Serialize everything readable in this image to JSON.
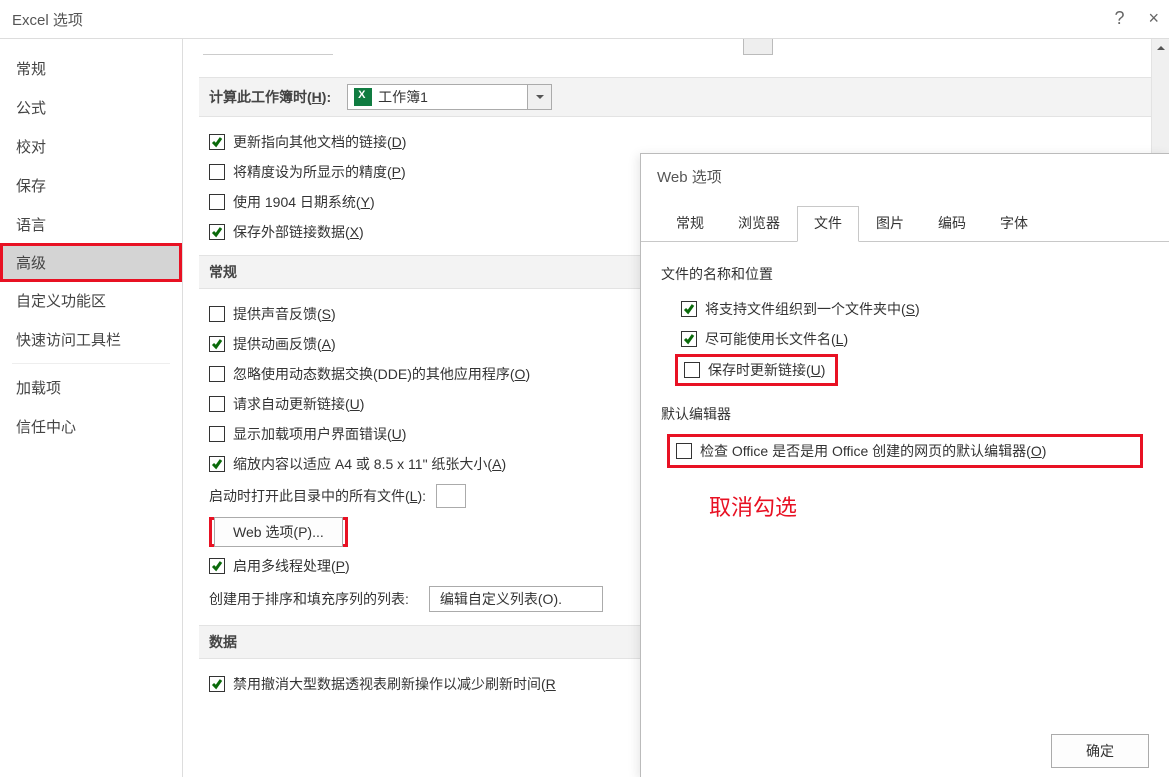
{
  "window": {
    "title": "Excel 选项",
    "help_icon": "?",
    "close_icon": "×"
  },
  "sidebar": {
    "items": [
      {
        "label": "常规"
      },
      {
        "label": "公式"
      },
      {
        "label": "校对"
      },
      {
        "label": "保存"
      },
      {
        "label": "语言"
      },
      {
        "label": "高级",
        "selected": true
      },
      {
        "label": "自定义功能区"
      },
      {
        "label": "快速访问工具栏"
      },
      {
        "label": "加载项"
      },
      {
        "label": "信任中心"
      }
    ]
  },
  "workbook_section": {
    "heading_prefix": "计算此工作簿时(",
    "heading_hotkey": "H",
    "heading_suffix": "):",
    "workbook_name": "工作簿1",
    "options": [
      {
        "checked": true,
        "text": "更新指向其他文档的链接(",
        "hot": "D",
        "tail": ")"
      },
      {
        "checked": false,
        "text": "将精度设为所显示的精度(",
        "hot": "P",
        "tail": ")"
      },
      {
        "checked": false,
        "text": "使用 1904 日期系统(",
        "hot": "Y",
        "tail": ")"
      },
      {
        "checked": true,
        "text": "保存外部链接数据(",
        "hot": "X",
        "tail": ")"
      }
    ]
  },
  "general_section": {
    "heading": "常规",
    "options": [
      {
        "checked": false,
        "text": "提供声音反馈(",
        "hot": "S",
        "tail": ")"
      },
      {
        "checked": true,
        "text": "提供动画反馈(",
        "hot": "A",
        "tail": ")"
      },
      {
        "checked": false,
        "text": "忽略使用动态数据交换(DDE)的其他应用程序(",
        "hot": "O",
        "tail": ")"
      },
      {
        "checked": false,
        "text": "请求自动更新链接(",
        "hot": "U",
        "tail": ")"
      },
      {
        "checked": false,
        "text": "显示加载项用户界面错误(",
        "hot": "U",
        "tail": ")"
      },
      {
        "checked": true,
        "text": "缩放内容以适应 A4 或 8.5 x 11\" 纸张大小(",
        "hot": "A",
        "tail": ")"
      }
    ],
    "startup_label_pre": "启动时打开此目录中的所有文件(",
    "startup_hot": "L",
    "startup_label_post": "):",
    "web_options_btn": "Web 选项(P)...",
    "multithread": {
      "checked": true,
      "text": "启用多线程处理(",
      "hot": "P",
      "tail": ")"
    },
    "sortlist_label": "创建用于排序和填充序列的列表:",
    "sortlist_btn": "编辑自定义列表(O)."
  },
  "data_section": {
    "heading": "数据",
    "option": {
      "checked": true,
      "text": "禁用撤消大型数据透视表刷新操作以减少刷新时间(",
      "hot": "R",
      "tail": ""
    }
  },
  "dialog": {
    "title": "Web 选项",
    "tabs": [
      {
        "label": "常规"
      },
      {
        "label": "浏览器"
      },
      {
        "label": "文件",
        "active": true
      },
      {
        "label": "图片"
      },
      {
        "label": "编码"
      },
      {
        "label": "字体"
      }
    ],
    "group1_label": "文件的名称和位置",
    "group1_options": [
      {
        "checked": true,
        "text": "将支持文件组织到一个文件夹中(",
        "hot": "S",
        "tail": ")"
      },
      {
        "checked": true,
        "text": "尽可能使用长文件名(",
        "hot": "L",
        "tail": ")"
      }
    ],
    "highlight_option": {
      "checked": false,
      "text": "保存时更新链接(",
      "hot": "U",
      "tail": ")"
    },
    "group2_label": "默认编辑器",
    "group2_option": {
      "checked": false,
      "text": "检查 Office 是否是用 Office 创建的网页的默认编辑器(",
      "hot": "O",
      "tail": ")"
    },
    "annotation": "取消勾选",
    "ok_button": "确定"
  }
}
